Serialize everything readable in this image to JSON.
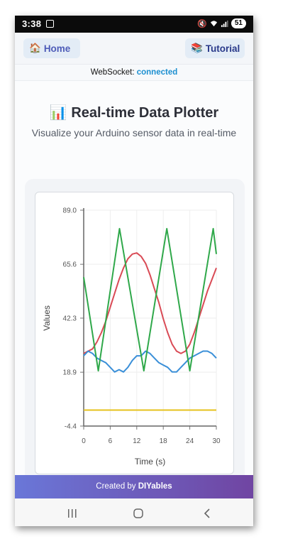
{
  "status_bar": {
    "time": "3:38",
    "battery": "51"
  },
  "header": {
    "home_label": "Home",
    "tutorial_label": "Tutorial"
  },
  "websocket": {
    "label": "WebSocket:",
    "status": "connected"
  },
  "page": {
    "title": "Real-time Data Plotter",
    "subtitle": "Visualize your Arduino sensor data in real-time"
  },
  "chart_data": {
    "type": "line",
    "xlabel": "Time (s)",
    "ylabel": "Values",
    "xlim": [
      0,
      30
    ],
    "ylim": [
      -4.4,
      89.0
    ],
    "xticks": [
      "0",
      "6",
      "12",
      "18",
      "24",
      "30"
    ],
    "yticks": [
      "89.0",
      "65.6",
      "42.3",
      "18.9",
      "-4.4"
    ],
    "grid": true,
    "series": [
      {
        "color": "#d94a55",
        "x": [
          0,
          1,
          2,
          3,
          4,
          5,
          6,
          7,
          8,
          9,
          10,
          11,
          12,
          13,
          14,
          15,
          16,
          17,
          18,
          19,
          20,
          21,
          22,
          23,
          24,
          25,
          26,
          27,
          28,
          29,
          30
        ],
        "values": [
          27,
          28,
          29,
          32,
          36,
          41,
          47,
          53,
          59,
          64,
          68,
          70,
          70.5,
          69,
          66,
          61,
          55,
          49,
          42,
          36,
          31,
          28,
          27,
          28,
          31,
          36,
          42,
          48,
          54,
          59,
          64
        ]
      },
      {
        "color": "#3a8fd8",
        "x": [
          0,
          1,
          2,
          3,
          4,
          5,
          6,
          7,
          8,
          9,
          10,
          11,
          12,
          13,
          14,
          15,
          16,
          17,
          18,
          19,
          20,
          21,
          22,
          23,
          24,
          25,
          26,
          27,
          28,
          29,
          30
        ],
        "values": [
          26,
          28,
          27,
          25,
          24,
          23,
          21,
          19,
          20,
          19,
          21,
          24,
          26,
          26,
          28,
          27,
          25,
          23,
          22,
          21,
          19,
          19,
          21,
          23,
          25,
          26,
          27,
          28,
          28,
          27,
          25
        ]
      },
      {
        "color": "#2fa84a",
        "x": [
          0,
          3.3,
          8.1,
          13.6,
          18.8,
          24.0,
          29.3,
          30
        ],
        "values": [
          60,
          19.5,
          81,
          19.5,
          81,
          19.5,
          81,
          70
        ]
      },
      {
        "color": "#e6c21c",
        "x": [
          0,
          30
        ],
        "values": [
          2.5,
          2.5
        ]
      }
    ]
  },
  "footer": {
    "prefix": "Created by ",
    "brand": "DIYables"
  },
  "icons": {
    "home": "house-emoji-icon",
    "tutorial": "books-emoji-icon",
    "title": "bar-chart-emoji-icon"
  }
}
